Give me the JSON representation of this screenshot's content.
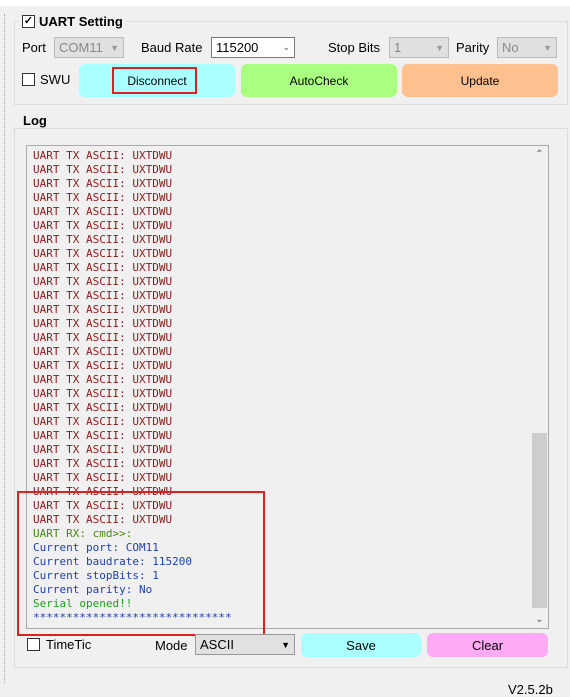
{
  "uart": {
    "title": "UART Setting",
    "enabled": true,
    "port_label": "Port",
    "port_value": "COM11",
    "baud_label": "Baud Rate",
    "baud_value": "115200",
    "stop_label": "Stop Bits",
    "stop_value": "1",
    "parity_label": "Parity",
    "parity_value": "No",
    "swu_label": "SWU",
    "swu_checked": false,
    "disconnect": "Disconnect",
    "autocheck": "AutoCheck",
    "update": "Update"
  },
  "log": {
    "title": "Log",
    "lines": [
      {
        "text": "UART TX ASCII: UXTDWU",
        "color": "#8b1c1c",
        "repeat": 27
      },
      {
        "text": "UART RX: cmd>>:",
        "color": "#4a8a10"
      },
      {
        "text": "Current port: COM11",
        "color": "#2040b0"
      },
      {
        "text": "Current baudrate: 115200",
        "color": "#2040b0"
      },
      {
        "text": "Current stopBits: 1",
        "color": "#2040b0"
      },
      {
        "text": "Current parity: No",
        "color": "#2040b0"
      },
      {
        "text": "Serial opened!!",
        "color": "#20a020"
      },
      {
        "text": "******************************",
        "color": "#2040b0"
      }
    ],
    "timetic_label": "TimeTic",
    "mode_label": "Mode",
    "mode_value": "ASCII",
    "save": "Save",
    "clear": "Clear"
  },
  "version": "V2.5.2b",
  "colors": {
    "disconnect": "#aaffff",
    "autocheck": "#aaff80",
    "update": "#ffc090",
    "save": "#aaffff",
    "clear": "#ffaaf5",
    "highlight": "#e02020"
  }
}
